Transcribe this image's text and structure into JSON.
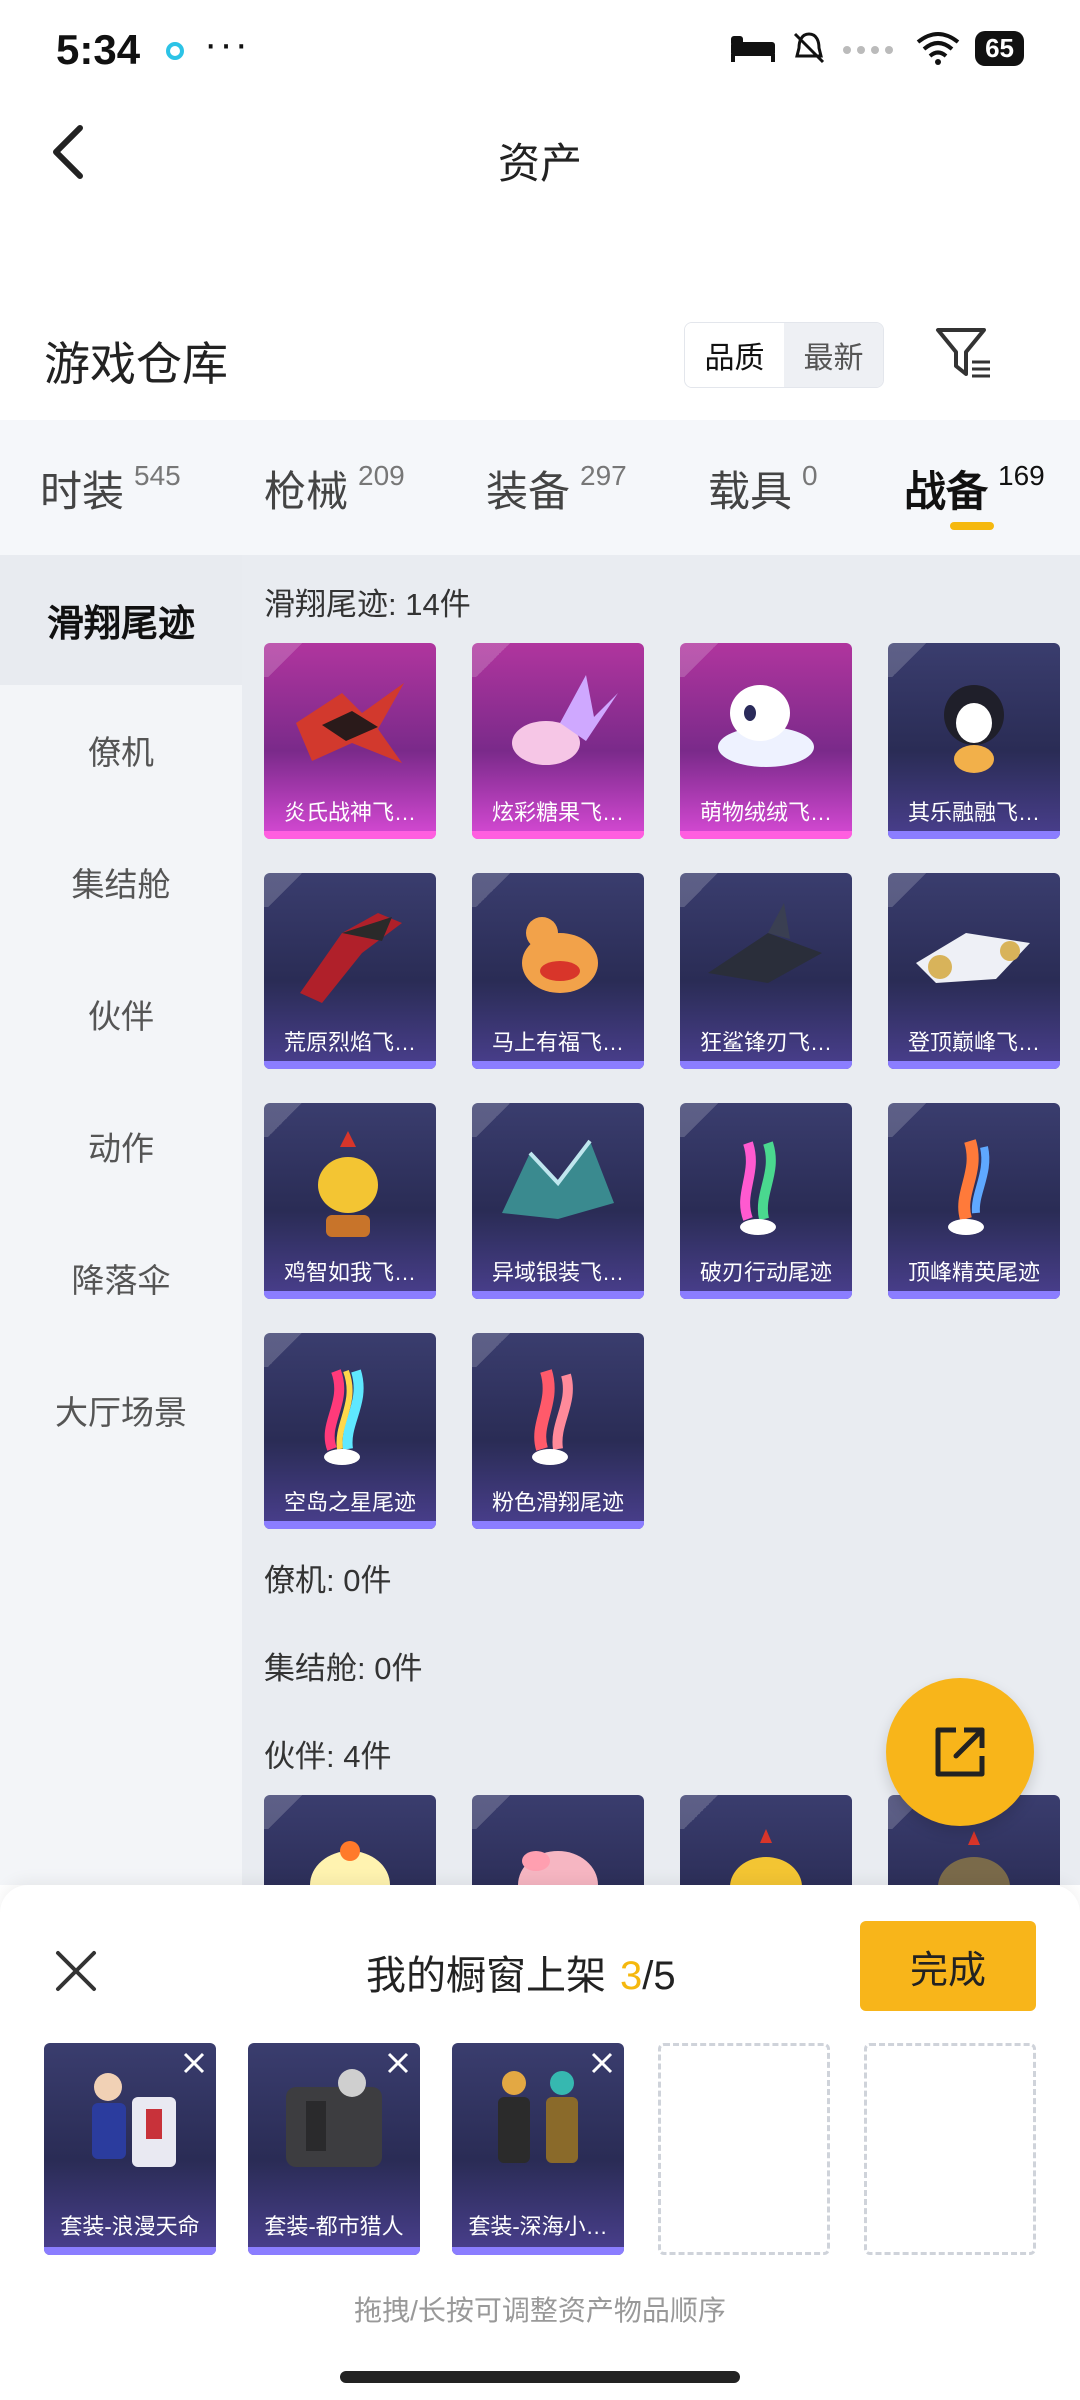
{
  "status_bar": {
    "time": "5:34",
    "battery": "65"
  },
  "header": {
    "title": "资产"
  },
  "warehouse": {
    "title": "游戏仓库",
    "sort": [
      "品质",
      "最新"
    ],
    "sort_selected": "品质"
  },
  "tabs": [
    {
      "label": "时装",
      "count": "545"
    },
    {
      "label": "枪械",
      "count": "209"
    },
    {
      "label": "装备",
      "count": "297"
    },
    {
      "label": "载具",
      "count": "0"
    },
    {
      "label": "战备",
      "count": "169",
      "active": true
    }
  ],
  "sidebar": [
    {
      "label": "滑翔尾迹",
      "active": true
    },
    {
      "label": "僚机"
    },
    {
      "label": "集结舱"
    },
    {
      "label": "伙伴"
    },
    {
      "label": "动作"
    },
    {
      "label": "降落伞"
    },
    {
      "label": "大厅场景"
    }
  ],
  "sections": {
    "glide": "滑翔尾迹: 14件",
    "wingman": "僚机: 0件",
    "pod": "集结舱: 0件",
    "partner": "伙伴: 4件"
  },
  "items": [
    {
      "name": "炎氏战神飞…",
      "rarity": "pink"
    },
    {
      "name": "炫彩糖果飞…",
      "rarity": "pink"
    },
    {
      "name": "萌物绒绒飞…",
      "rarity": "pink"
    },
    {
      "name": "其乐融融飞…",
      "rarity": "purple"
    },
    {
      "name": "荒原烈焰飞…",
      "rarity": "purple"
    },
    {
      "name": "马上有福飞…",
      "rarity": "purple"
    },
    {
      "name": "狂鲨锋刃飞…",
      "rarity": "purple"
    },
    {
      "name": "登顶巅峰飞…",
      "rarity": "purple"
    },
    {
      "name": "鸡智如我飞…",
      "rarity": "purple"
    },
    {
      "name": "异域银装飞…",
      "rarity": "purple"
    },
    {
      "name": "破刃行动尾迹",
      "rarity": "purple"
    },
    {
      "name": "顶峰精英尾迹",
      "rarity": "purple"
    },
    {
      "name": "空岛之星尾迹",
      "rarity": "purple"
    },
    {
      "name": "粉色滑翔尾迹",
      "rarity": "purple"
    }
  ],
  "showcase": {
    "title": "我的橱窗上架",
    "count": "3",
    "total": "/5",
    "done_label": "完成",
    "items": [
      "套装-浪漫天命",
      "套装-都市猎人",
      "套装-深海小…"
    ],
    "hint": "拖拽/长按可调整资产物品顺序"
  },
  "colors": {
    "accent": "#f8b51a",
    "pink_rarity": "#d84ad6",
    "purple_rarity": "#8b7dff"
  }
}
